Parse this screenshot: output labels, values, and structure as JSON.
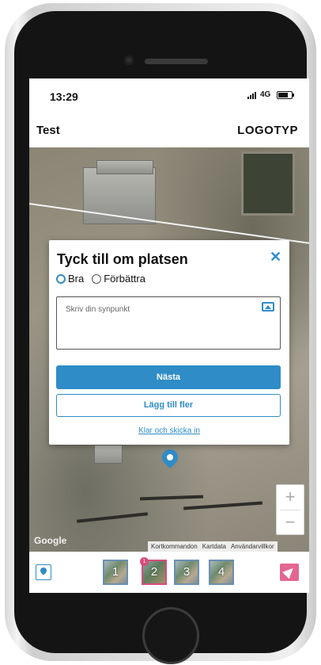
{
  "status": {
    "time": "13:29",
    "network": "4G"
  },
  "header": {
    "title": "Test",
    "logo": "LOGOTYP"
  },
  "modal": {
    "title": "Tyck till om platsen",
    "close_icon": "close-icon",
    "options": [
      {
        "label": "Bra",
        "selected": true
      },
      {
        "label": "Förbättra",
        "selected": false
      }
    ],
    "placeholder": "Skriv din synpunkt",
    "image_icon": "image-upload-icon",
    "primary_button": "Nästa",
    "secondary_button": "Lägg till fler",
    "link": "Klar och skicka in"
  },
  "map": {
    "zoom_in": "+",
    "zoom_out": "−",
    "google": "Google",
    "attribution": [
      "Kortkommandon",
      "Kartdata",
      "Användarvillkor"
    ],
    "pin_icon": "map-pin-icon"
  },
  "bottom": {
    "location_icon": "location-icon",
    "thumbnails": [
      {
        "label": "1",
        "active": false
      },
      {
        "label": "2",
        "active": true,
        "badge": "1"
      },
      {
        "label": "3",
        "active": false
      },
      {
        "label": "4",
        "active": false
      }
    ],
    "send_icon": "send-icon"
  },
  "colors": {
    "accent": "#2f8cc7",
    "send": "#e26791",
    "badge": "#d94b7b"
  }
}
